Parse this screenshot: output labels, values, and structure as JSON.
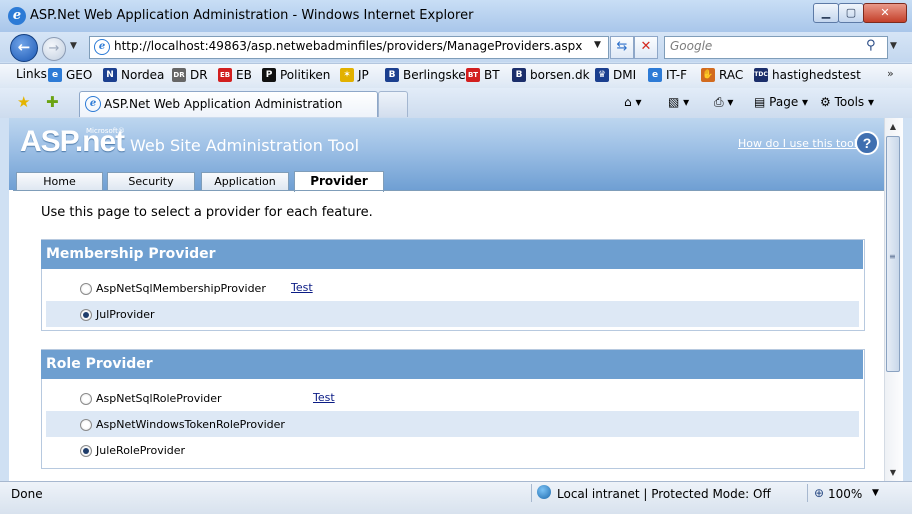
{
  "window": {
    "title": "ASP.Net Web Application Administration - Windows Internet Explorer",
    "minimize": "▁",
    "maximize": "▢",
    "close": "✕"
  },
  "address": {
    "url": "http://localhost:49863/asp.netwebadminfiles/providers/ManageProviders.aspx",
    "search_placeholder": "Google"
  },
  "links": {
    "label": "Links",
    "items": [
      {
        "label": "GEO",
        "color": "#2d7bd6",
        "glyph": "e"
      },
      {
        "label": "Nordea",
        "color": "#1b3f8f",
        "glyph": "N"
      },
      {
        "label": "DR",
        "color": "#666666",
        "glyph": "DR"
      },
      {
        "label": "EB",
        "color": "#d21f1f",
        "glyph": "EB"
      },
      {
        "label": "Politiken",
        "color": "#111111",
        "glyph": "P"
      },
      {
        "label": "JP",
        "color": "#e2b100",
        "glyph": "✶"
      },
      {
        "label": "Berlingske",
        "color": "#1b3f8f",
        "glyph": "B"
      },
      {
        "label": "BT",
        "color": "#d21f1f",
        "glyph": "BT"
      },
      {
        "label": "borsen.dk",
        "color": "#1b2e6b",
        "glyph": "B"
      },
      {
        "label": "DMI",
        "color": "#1b3f8f",
        "glyph": "♛"
      },
      {
        "label": "IT-F",
        "color": "#2d7bd6",
        "glyph": "e"
      },
      {
        "label": "RAC",
        "color": "#d26b1f",
        "glyph": "✋"
      },
      {
        "label": "hastighedstest",
        "color": "#1b2e6b",
        "glyph": "TDC"
      }
    ],
    "more": "»"
  },
  "tab": {
    "title": "ASP.Net Web Application Administration"
  },
  "commands": {
    "page": "Page",
    "tools": "Tools"
  },
  "site": {
    "logo": "ASP.net",
    "logo_ms": "Microsoft®",
    "title": "Web Site Administration Tool",
    "help": "How do I use this tool?",
    "help_icon": "?",
    "tabs": [
      "Home",
      "Security",
      "Application",
      "Provider"
    ],
    "intro": "Use this page to select a provider for each feature."
  },
  "membership": {
    "heading": "Membership Provider",
    "providers": [
      {
        "name": "AspNetSqlMembershipProvider",
        "selected": false,
        "test": "Test"
      },
      {
        "name": "JulProvider",
        "selected": true
      }
    ]
  },
  "roles": {
    "heading": "Role Provider",
    "providers": [
      {
        "name": "AspNetSqlRoleProvider",
        "selected": false,
        "test": "Test"
      },
      {
        "name": "AspNetWindowsTokenRoleProvider",
        "selected": false
      },
      {
        "name": "JuleRoleProvider",
        "selected": true
      }
    ]
  },
  "status": {
    "text": "Done",
    "zone": "Local intranet | Protected Mode: Off",
    "zoom": "100%"
  }
}
